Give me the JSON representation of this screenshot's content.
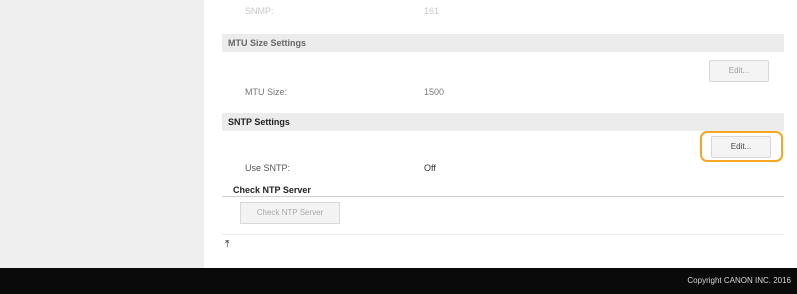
{
  "faded_row": {
    "label": "SNMP:",
    "value": "161"
  },
  "mtu_section": {
    "title": "MTU Size Settings",
    "edit_label": "Edit...",
    "field_label": "MTU Size:",
    "field_value": "1500"
  },
  "sntp_section": {
    "title": "SNTP Settings",
    "edit_label": "Edit...",
    "field_label": "Use SNTP:",
    "field_value": "Off",
    "check_heading": "Check NTP Server",
    "check_button_label": "Check NTP Server"
  },
  "top_link": {
    "symbol": "⤒"
  },
  "footer": {
    "copyright": "Copyright CANON INC. 2016"
  },
  "colors": {
    "highlight": "#f5a623",
    "footer_bg": "#0a0a0a",
    "section_bg": "#ececec"
  }
}
